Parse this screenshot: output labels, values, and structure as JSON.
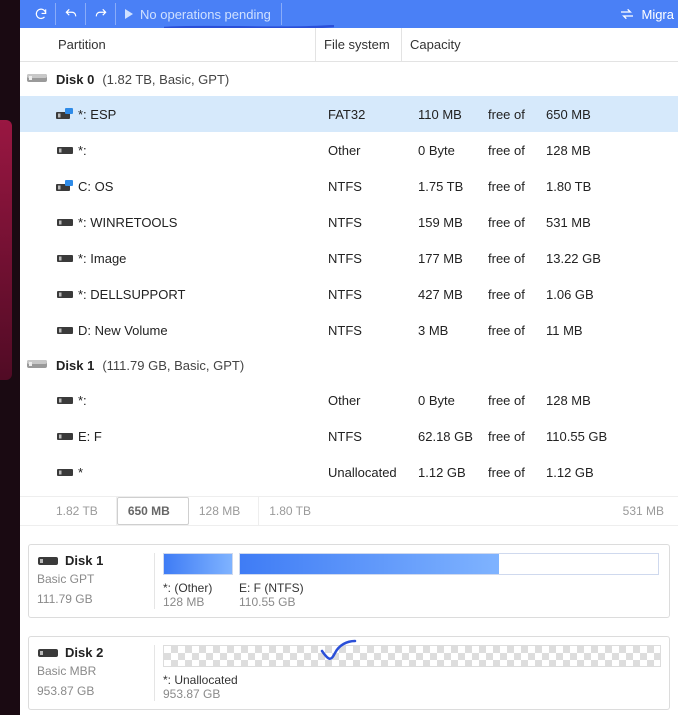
{
  "toolbar": {
    "pending_text": "No operations pending",
    "right_label": "Migra"
  },
  "columns": {
    "partition": "Partition",
    "filesystem": "File system",
    "capacity": "Capacity"
  },
  "free_of_label": "free of",
  "disks": [
    {
      "name": "Disk 0",
      "info": "(1.82 TB, Basic, GPT)",
      "partitions": [
        {
          "icon": "sys",
          "name": "*: ESP",
          "fs": "FAT32",
          "free": "110 MB",
          "total": "650 MB",
          "selected": true
        },
        {
          "icon": "vol",
          "name": "*:",
          "fs": "Other",
          "free": "0 Byte",
          "total": "128 MB"
        },
        {
          "icon": "sys",
          "name": "C: OS",
          "fs": "NTFS",
          "free": "1.75 TB",
          "total": "1.80 TB"
        },
        {
          "icon": "vol",
          "name": "*: WINRETOOLS",
          "fs": "NTFS",
          "free": "159 MB",
          "total": "531 MB"
        },
        {
          "icon": "vol",
          "name": "*: Image",
          "fs": "NTFS",
          "free": "177 MB",
          "total": "13.22 GB"
        },
        {
          "icon": "vol",
          "name": "*: DELLSUPPORT",
          "fs": "NTFS",
          "free": "427 MB",
          "total": "1.06 GB"
        },
        {
          "icon": "vol",
          "name": "D: New Volume",
          "fs": "NTFS",
          "free": "3 MB",
          "total": "11 MB"
        }
      ]
    },
    {
      "name": "Disk 1",
      "info": "(111.79 GB, Basic, GPT)",
      "partitions": [
        {
          "icon": "vol",
          "name": "*:",
          "fs": "Other",
          "free": "0 Byte",
          "total": "128 MB"
        },
        {
          "icon": "vol",
          "name": "E: F",
          "fs": "NTFS",
          "free": "62.18 GB",
          "total": "110.55 GB"
        },
        {
          "icon": "vol",
          "name": "*",
          "fs": "Unallocated",
          "free": "1.12 GB",
          "total": "1.12 GB"
        }
      ]
    }
  ],
  "summary0": {
    "segs": [
      "1.82 TB",
      "650 MB",
      "128 MB",
      "1.80 TB"
    ],
    "tail": "531 MB"
  },
  "card1": {
    "title": "Disk 1",
    "sub1": "Basic GPT",
    "sub2": "111.79 GB",
    "segA": {
      "label": "*: (Other)",
      "sub": "128 MB",
      "widthPx": 70,
      "fillPct": 100
    },
    "segB": {
      "label": "E: F (NTFS)",
      "sub": "110.55 GB",
      "widthPx": 420,
      "fillPct": 62
    }
  },
  "card2": {
    "title": "Disk 2",
    "sub1": "Basic MBR",
    "sub2": "953.87 GB",
    "seg": {
      "label": "*: Unallocated",
      "sub": "953.87 GB"
    }
  }
}
